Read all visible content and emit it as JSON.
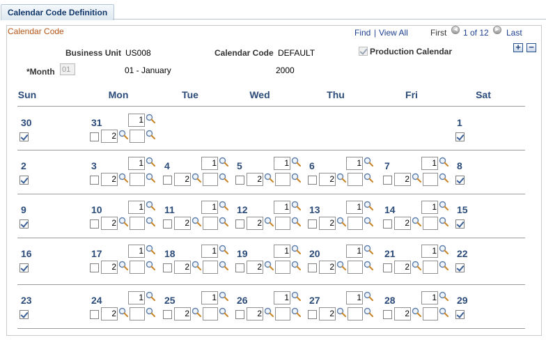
{
  "tab": {
    "label": "Calendar Code Definition"
  },
  "panel": {
    "title": "Calendar Code",
    "nav": {
      "find": "Find",
      "sep": "|",
      "view_all": "View All",
      "first": "First",
      "range": "1 of 12",
      "last": "Last"
    }
  },
  "header": {
    "business_unit_label": "Business Unit",
    "business_unit": "US008",
    "calendar_code_label": "Calendar Code",
    "calendar_code": "DEFAULT",
    "production_calendar_label": "Production Calendar",
    "production_calendar": true,
    "month_label": "*Month",
    "month_value": "01",
    "month_name": "01 - January",
    "year": "2000"
  },
  "days": [
    "Sun",
    "Mon",
    "Tue",
    "Wed",
    "Thu",
    "Fri",
    "Sat"
  ],
  "weeks": [
    {
      "cells": [
        {
          "day": "30",
          "weekend": true,
          "checked": true
        },
        {
          "day": "31",
          "weekend": false,
          "checked": false,
          "f1": "1",
          "f2": "2",
          "f3": ""
        },
        null,
        null,
        null,
        null,
        {
          "day": "1",
          "weekend": true,
          "checked": true
        }
      ]
    },
    {
      "cells": [
        {
          "day": "2",
          "weekend": true,
          "checked": true
        },
        {
          "day": "3",
          "weekend": false,
          "checked": false,
          "f1": "1",
          "f2": "2",
          "f3": ""
        },
        {
          "day": "4",
          "weekend": false,
          "checked": false,
          "f1": "1",
          "f2": "2",
          "f3": ""
        },
        {
          "day": "5",
          "weekend": false,
          "checked": false,
          "f1": "1",
          "f2": "2",
          "f3": ""
        },
        {
          "day": "6",
          "weekend": false,
          "checked": false,
          "f1": "1",
          "f2": "2",
          "f3": ""
        },
        {
          "day": "7",
          "weekend": false,
          "checked": false,
          "f1": "1",
          "f2": "2",
          "f3": ""
        },
        {
          "day": "8",
          "weekend": true,
          "checked": true
        }
      ]
    },
    {
      "cells": [
        {
          "day": "9",
          "weekend": true,
          "checked": true
        },
        {
          "day": "10",
          "weekend": false,
          "checked": false,
          "f1": "1",
          "f2": "2",
          "f3": ""
        },
        {
          "day": "11",
          "weekend": false,
          "checked": false,
          "f1": "1",
          "f2": "2",
          "f3": ""
        },
        {
          "day": "12",
          "weekend": false,
          "checked": false,
          "f1": "1",
          "f2": "2",
          "f3": ""
        },
        {
          "day": "13",
          "weekend": false,
          "checked": false,
          "f1": "1",
          "f2": "2",
          "f3": ""
        },
        {
          "day": "14",
          "weekend": false,
          "checked": false,
          "f1": "1",
          "f2": "2",
          "f3": ""
        },
        {
          "day": "15",
          "weekend": true,
          "checked": true
        }
      ]
    },
    {
      "cells": [
        {
          "day": "16",
          "weekend": true,
          "checked": true
        },
        {
          "day": "17",
          "weekend": false,
          "checked": false,
          "f1": "1",
          "f2": "2",
          "f3": ""
        },
        {
          "day": "18",
          "weekend": false,
          "checked": false,
          "f1": "1",
          "f2": "2",
          "f3": ""
        },
        {
          "day": "19",
          "weekend": false,
          "checked": false,
          "f1": "1",
          "f2": "2",
          "f3": ""
        },
        {
          "day": "20",
          "weekend": false,
          "checked": false,
          "f1": "1",
          "f2": "2",
          "f3": ""
        },
        {
          "day": "21",
          "weekend": false,
          "checked": false,
          "f1": "1",
          "f2": "2",
          "f3": ""
        },
        {
          "day": "22",
          "weekend": true,
          "checked": true
        }
      ]
    },
    {
      "cells": [
        {
          "day": "23",
          "weekend": true,
          "checked": true
        },
        {
          "day": "24",
          "weekend": false,
          "checked": false,
          "f1": "1",
          "f2": "2",
          "f3": ""
        },
        {
          "day": "25",
          "weekend": false,
          "checked": false,
          "f1": "1",
          "f2": "2",
          "f3": ""
        },
        {
          "day": "26",
          "weekend": false,
          "checked": false,
          "f1": "1",
          "f2": "2",
          "f3": ""
        },
        {
          "day": "27",
          "weekend": false,
          "checked": false,
          "f1": "1",
          "f2": "2",
          "f3": ""
        },
        {
          "day": "28",
          "weekend": false,
          "checked": false,
          "f1": "1",
          "f2": "2",
          "f3": ""
        },
        {
          "day": "29",
          "weekend": true,
          "checked": true
        }
      ]
    }
  ],
  "icons": {
    "prompt": "magnifier-icon",
    "prev": "left-arrow-icon",
    "next": "right-arrow-icon",
    "add": "plus-icon",
    "remove": "minus-icon"
  },
  "colors": {
    "day_text": "#2b4b79",
    "link": "#1d3f8f",
    "panel_title": "#b35516",
    "tab_text": "#12386b"
  }
}
